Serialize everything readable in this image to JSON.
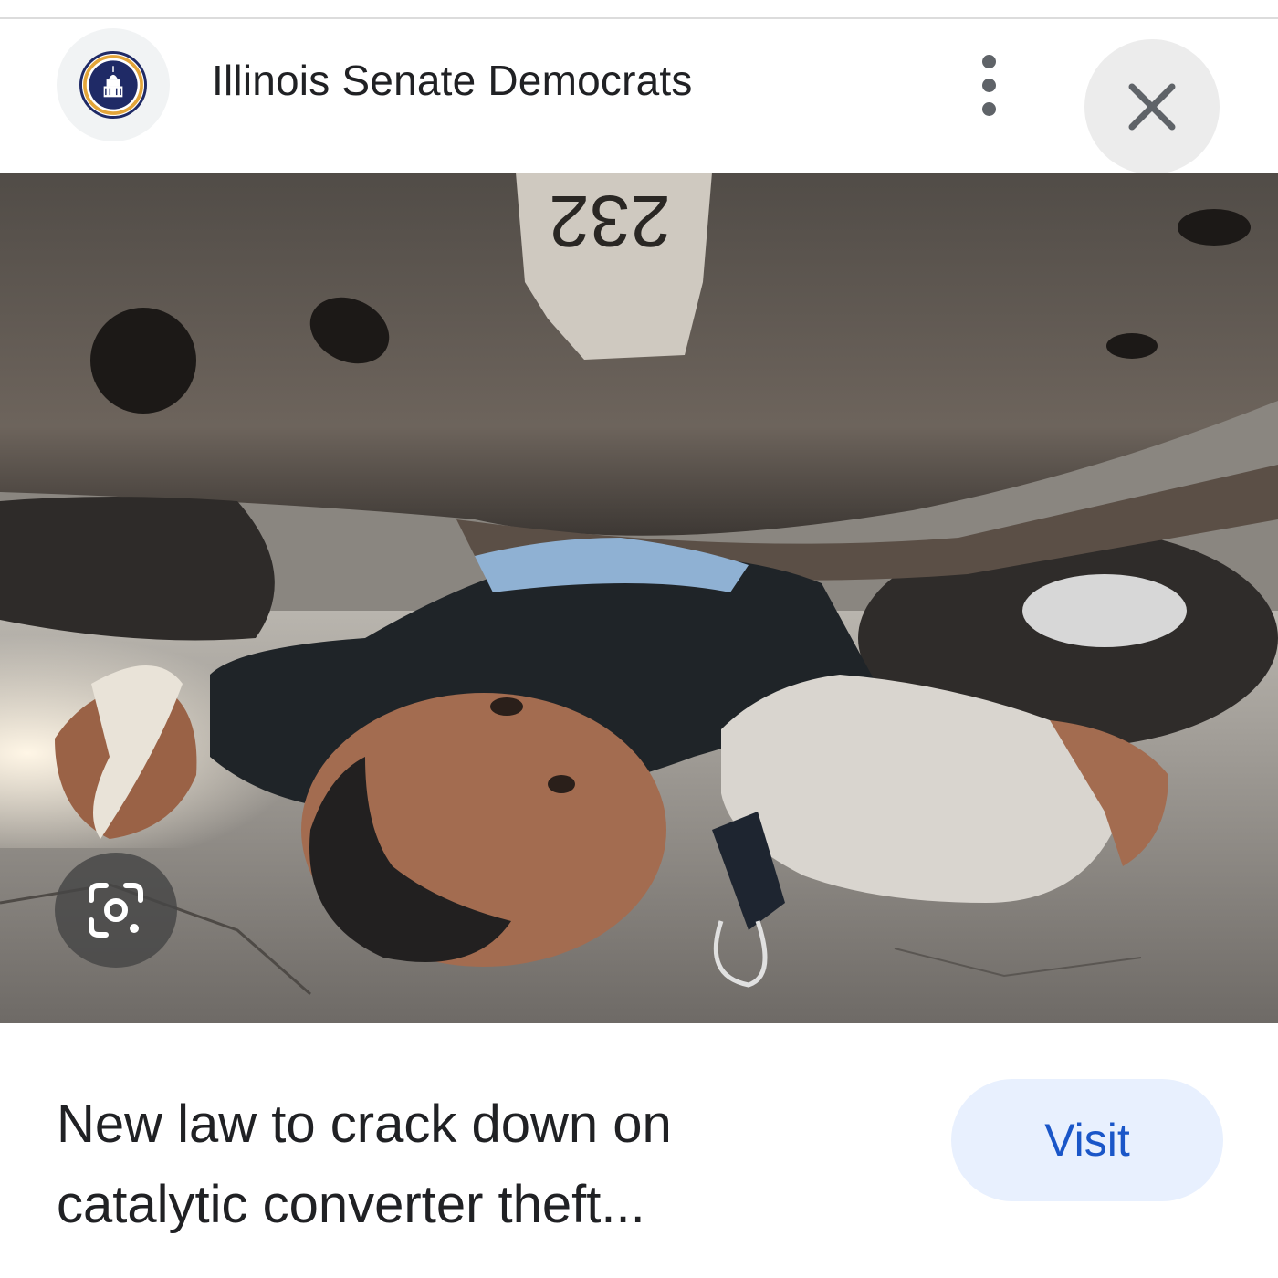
{
  "header": {
    "site_name": "Illinois Senate Democrats",
    "logo_icon": "illinois-senate-seal-icon",
    "more_icon": "more-vert-icon",
    "close_icon": "close-icon"
  },
  "image": {
    "plate_number": "232",
    "lens_icon": "google-lens-icon"
  },
  "result": {
    "headline_line1": "New law to crack down on",
    "headline_line2": "catalytic converter theft...",
    "visit_label": "Visit"
  },
  "colors": {
    "visit_bg": "#e8f0fe",
    "visit_text": "#1a56c8",
    "title_text": "#202124"
  }
}
